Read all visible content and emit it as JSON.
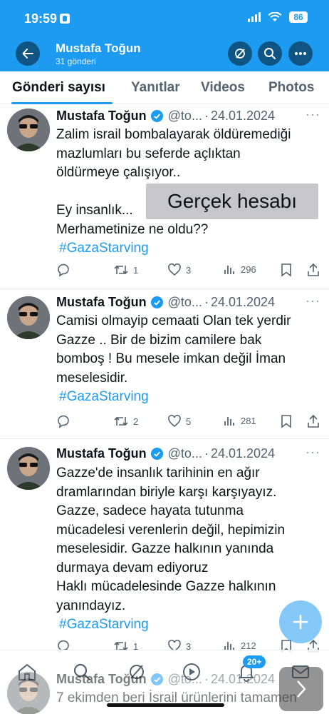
{
  "status_bar": {
    "time": "19:59",
    "battery": "86"
  },
  "header": {
    "name": "Mustafa Toğun",
    "post_count": "31 gönderi"
  },
  "tabs": [
    {
      "label": "Gönderi sayısı"
    },
    {
      "label": "Yanıtlar"
    },
    {
      "label": "Videos"
    },
    {
      "label": "Photos"
    }
  ],
  "tweets": [
    {
      "name": "Mustafa Toğun",
      "handle": "@to...",
      "dot": "·",
      "date": "24.01.2024",
      "text": "Zalim israil bombalayarak öldüremediği\nmazlumları bu seferde açlıktan\nöldürmeye çalışıyor..\n\nEy insanlık...\nMerhametinize ne oldu??",
      "hashtag": "#GazaStarving",
      "retweets": "1",
      "likes": "3",
      "views": "296"
    },
    {
      "name": "Mustafa Toğun",
      "handle": "@to...",
      "dot": "·",
      "date": "24.01.2024",
      "text": "Camisi olmayip cemaati Olan tek yerdir\nGazze .. Bir de bizim camilere bak\nbomboş ! Bu mesele imkan değil İman\nmeselesidir.",
      "hashtag": "#GazaStarving",
      "retweets": "2",
      "likes": "5",
      "views": "281"
    },
    {
      "name": "Mustafa Toğun",
      "handle": "@to...",
      "dot": "·",
      "date": "24.01.2024",
      "text": "Gazze'de insanlık tarihinin en ağır\ndramlarından biriyle karşı karşıyayız.\nGazze, sadece hayata tutunma\nmücadelesi verenlerin değil, hepimizin\nmeselesidir. Gazze halkının yanında\ndurmaya devam ediyoruz\nHaklı mücadelesinde Gazze halkının\nyanındayız.",
      "hashtag": "#GazaStarving",
      "retweets": "1",
      "likes": "3",
      "views": "212"
    },
    {
      "name": "Mustafa Toğun",
      "handle": "@to...",
      "dot": "·",
      "date": "24.01.2024",
      "text": "7 ekimden beri İsrail ürünlerini tamamen"
    }
  ],
  "overlay": {
    "label": "Gerçek hesabı"
  },
  "bottom_nav": {
    "notifications_badge": "20+"
  },
  "colors": {
    "accent": "#1d9bf0",
    "text": "#0f1419",
    "muted": "#536471"
  }
}
